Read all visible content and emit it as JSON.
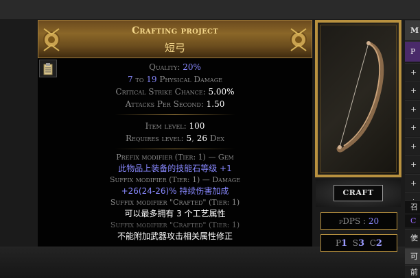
{
  "panel": {
    "title": "Crafting project",
    "subtitle": "短弓",
    "quality_label": "Quality:",
    "quality_value": "20%",
    "dmg_min": "7",
    "dmg_to": "to",
    "dmg_max": "19",
    "dmg_type": "Physical Damage",
    "crit_label": "Critical Strike Chance:",
    "crit_value": "5.00%",
    "aps_label": "Attacks Per Second:",
    "aps_value": "1.50",
    "ilvl_label": "Item level:",
    "ilvl_value": "100",
    "req_label": "Requires level:",
    "req_level": "5",
    "req_sep": ",",
    "req_dex": "26",
    "req_dex_label": "Dex",
    "mods": [
      {
        "header": "Prefix modifier (Tier: 1) — Gem",
        "text": "此物品上装备的技能石等级 +1"
      },
      {
        "header": "Suffix modifier (Tier: 1) — Damage",
        "text": "+26(24-26)% 持续伤害加成"
      },
      {
        "header": "Suffix modifier \"Crafted\" (Tier: 1)",
        "text": "可以最多拥有 3 个工艺属性"
      },
      {
        "header": "Suffix modifier \"Crafted\" (Tier: 1)",
        "text": "不能附加武器攻击相关属性修正"
      }
    ]
  },
  "craft_button": "CRAFT",
  "pdps": {
    "label": "pDPS :",
    "value": "20"
  },
  "sockets": {
    "p_label": "P",
    "p_value": "1",
    "s_label": "S",
    "s_value": "3",
    "c_label": "C",
    "c_value": "2"
  },
  "sidelist": [
    "M",
    "P",
    "+",
    "+",
    "+",
    "+",
    "+",
    "+",
    "+",
    "+",
    "召",
    "C",
    "使",
    "可",
    "前"
  ],
  "colors": {
    "gold": "#f3d68a",
    "magic": "#8888ff",
    "frame": "#b8913f"
  }
}
